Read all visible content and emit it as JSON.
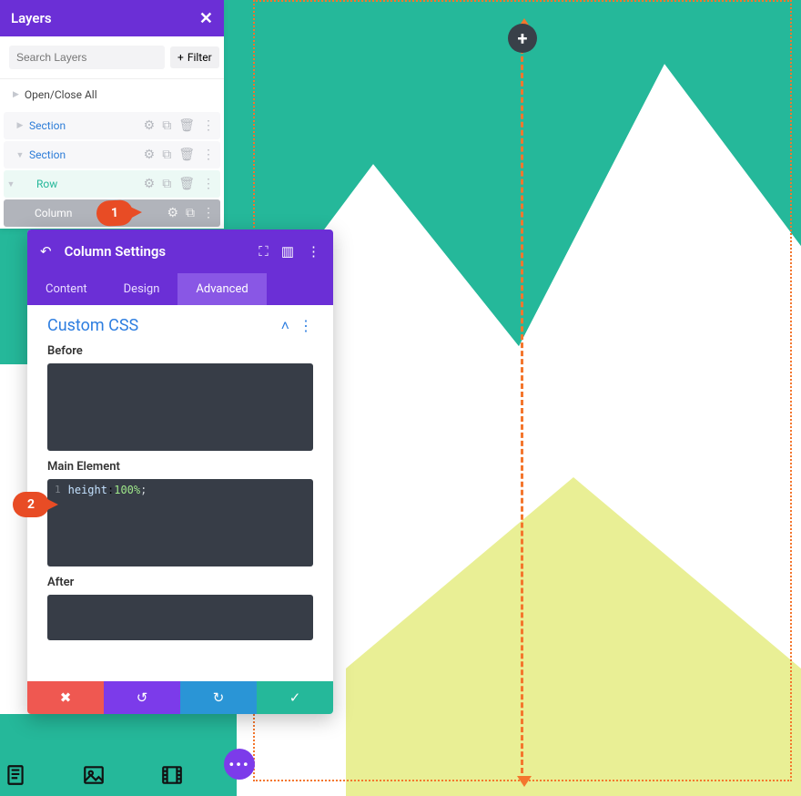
{
  "layers": {
    "title": "Layers",
    "search_placeholder": "Search Layers",
    "filter_label": "Filter",
    "open_close_label": "Open/Close All",
    "tree": [
      {
        "label": "Section",
        "kind": "section"
      },
      {
        "label": "Section",
        "kind": "section"
      },
      {
        "label": "Row",
        "kind": "row"
      },
      {
        "label": "Column",
        "kind": "column"
      }
    ]
  },
  "settings": {
    "title": "Column Settings",
    "tabs": {
      "content": "Content",
      "design": "Design",
      "advanced": "Advanced"
    },
    "section_title": "Custom CSS",
    "fields": {
      "before_label": "Before",
      "main_label": "Main Element",
      "after_label": "After"
    },
    "main_css": {
      "line_no": "1",
      "prop": "height",
      "value": "100%",
      "semi": ";"
    }
  },
  "annotations": {
    "one": "1",
    "two": "2"
  },
  "plus_label": "+"
}
